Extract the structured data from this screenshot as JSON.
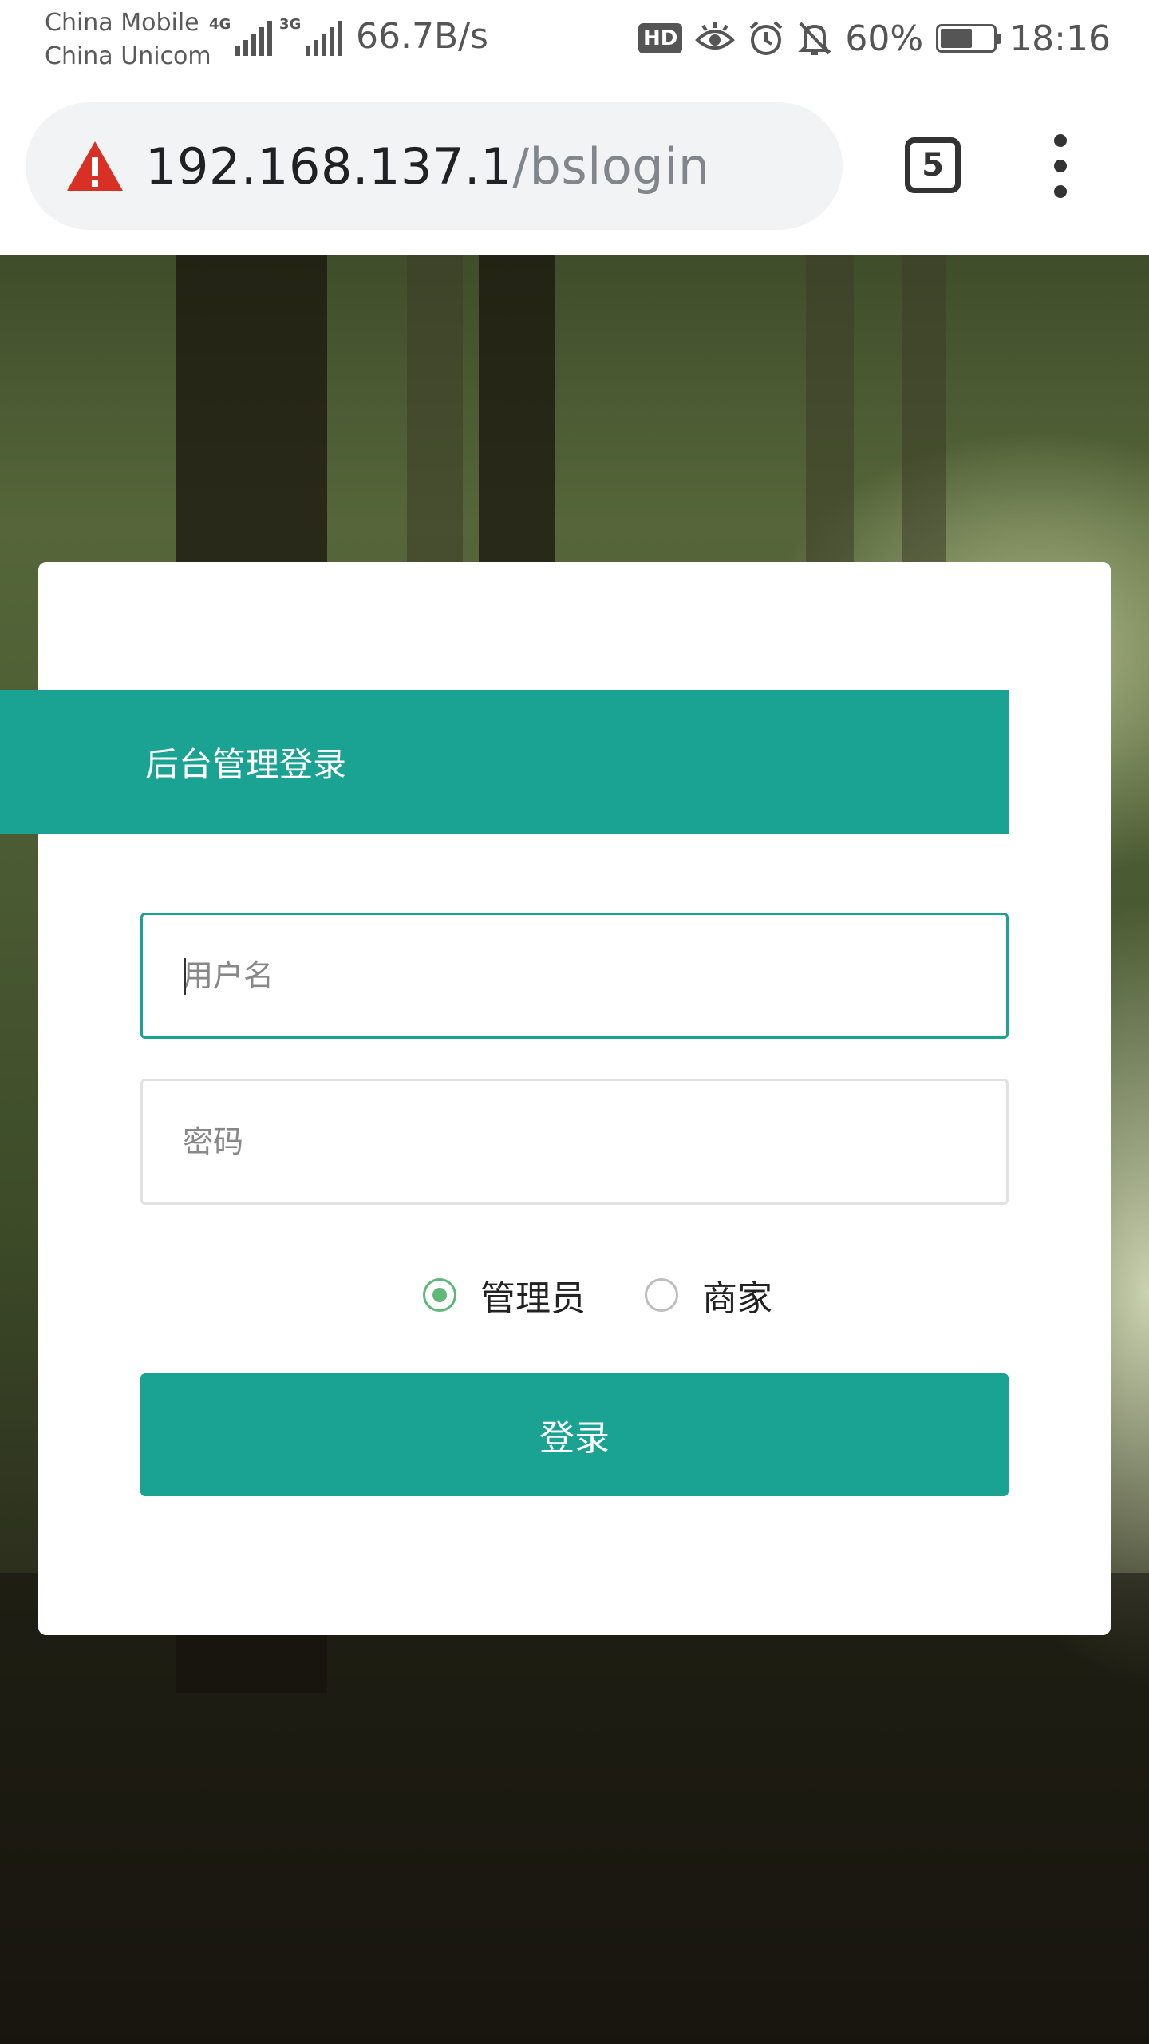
{
  "status_bar": {
    "carrier_1": "China Mobile",
    "carrier_2": "China Unicom",
    "network_1": "4G",
    "network_2": "3G",
    "net_speed": "66.7B/s",
    "hd_label": "HD",
    "battery_percent": "60%",
    "battery_level": 0.6,
    "time": "18:16"
  },
  "browser": {
    "url_host": "192.168.137.1",
    "url_path": "/bslogin",
    "tab_count": "5",
    "warning_icon": "warning-triangle-icon",
    "menu_icon": "more-vertical-icon"
  },
  "login": {
    "title": "后台管理登录",
    "username_placeholder": "用户名",
    "password_placeholder": "密码",
    "roles": [
      {
        "label": "管理员",
        "checked": true
      },
      {
        "label": "商家",
        "checked": false
      }
    ],
    "submit_label": "登录"
  },
  "colors": {
    "accent": "#1aa293",
    "radio_checked": "#5fb878",
    "warning": "#d93025"
  }
}
